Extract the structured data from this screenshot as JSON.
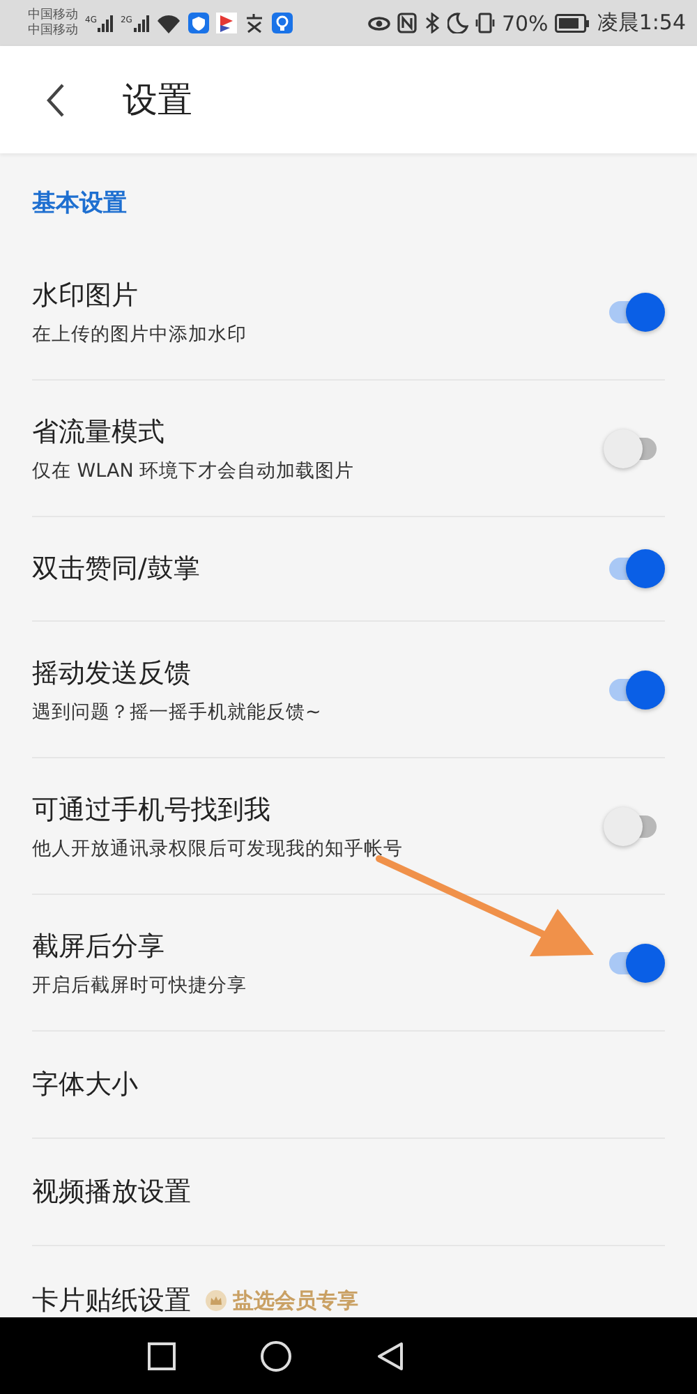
{
  "status_bar": {
    "carriers": [
      "中国移动",
      "中国移动"
    ],
    "network_1": "4G",
    "network_2": "2G",
    "battery": "70%",
    "time": "凌晨1:54"
  },
  "header": {
    "title": "设置"
  },
  "section": {
    "title": "基本设置"
  },
  "settings": [
    {
      "kind": "toggle",
      "title": "水印图片",
      "subtitle": "在上传的图片中添加水印",
      "on": true
    },
    {
      "kind": "toggle",
      "title": "省流量模式",
      "subtitle": "仅在 WLAN 环境下才会自动加载图片",
      "on": false
    },
    {
      "kind": "toggle",
      "title": "双击赞同/鼓掌",
      "on": true
    },
    {
      "kind": "toggle",
      "title": "摇动发送反馈",
      "subtitle": "遇到问题？摇一摇手机就能反馈~",
      "on": true
    },
    {
      "kind": "toggle",
      "title": "可通过手机号找到我",
      "subtitle": "他人开放通讯录权限后可发现我的知乎帐号",
      "on": false
    },
    {
      "kind": "toggle",
      "title": "截屏后分享",
      "subtitle": "开启后截屏时可快捷分享",
      "on": true
    },
    {
      "kind": "link",
      "title": "字体大小"
    },
    {
      "kind": "link",
      "title": "视频播放设置"
    },
    {
      "kind": "link",
      "title": "卡片贴纸设置",
      "badge": "盐选会员专享"
    }
  ]
}
